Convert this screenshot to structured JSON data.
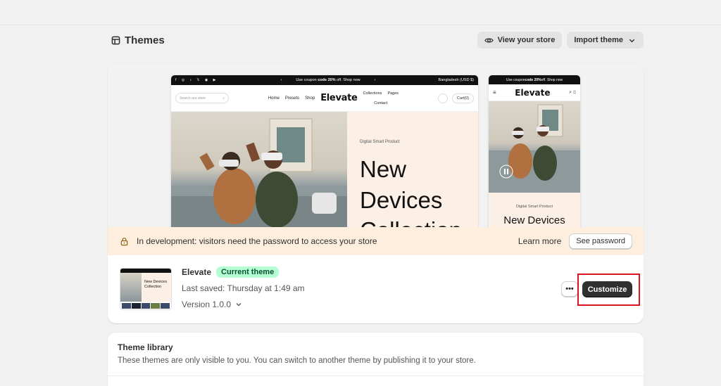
{
  "header": {
    "title": "Themes",
    "view_store_label": "View your store",
    "import_theme_label": "Import theme"
  },
  "preview": {
    "desktop": {
      "announcement_pre": "Use coupon ",
      "announcement_code": "code 20%",
      "announcement_post": " off. Shop now",
      "region": "Bangladesh (USD $)",
      "search_placeholder": "Search our store",
      "nav": [
        "Home",
        "Presets",
        "Shop"
      ],
      "nav_right": [
        "Collections",
        "Pages"
      ],
      "nav_contact": "Contact",
      "logo": "Elevate",
      "cart": "Cart(0)",
      "hero_small": "Digital Smart Product",
      "hero_big": "New Devices Collection"
    },
    "mobile": {
      "announcement_pre": "Use coupon ",
      "announcement_code": "code 20%",
      "announcement_post": " off. Shop now",
      "logo": "Elevate",
      "hero_small": "Digital Smart Product",
      "hero_big": "New Devices"
    }
  },
  "dev_banner": {
    "message": "In development: visitors need the password to access your store",
    "learn_more": "Learn more",
    "see_password": "See password",
    "color": "#feeede"
  },
  "current_theme": {
    "name": "Elevate",
    "badge": "Current theme",
    "last_saved": "Last saved: Thursday at 1:49 am",
    "version": "Version 1.0.0",
    "more_label": "•••",
    "customize_label": "Customize",
    "thumb_text": "New Devices Collection"
  },
  "library": {
    "title": "Theme library",
    "description": "These themes are only visible to you. You can switch to another theme by publishing it to your store."
  }
}
